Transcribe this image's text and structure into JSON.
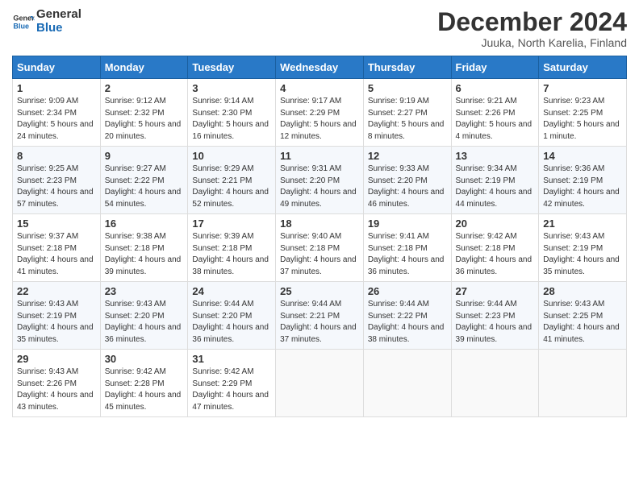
{
  "logo": {
    "line1": "General",
    "line2": "Blue"
  },
  "header": {
    "month": "December 2024",
    "location": "Juuka, North Karelia, Finland"
  },
  "days_of_week": [
    "Sunday",
    "Monday",
    "Tuesday",
    "Wednesday",
    "Thursday",
    "Friday",
    "Saturday"
  ],
  "weeks": [
    [
      {
        "day": "1",
        "sunrise": "9:09 AM",
        "sunset": "2:34 PM",
        "daylight": "5 hours and 24 minutes."
      },
      {
        "day": "2",
        "sunrise": "9:12 AM",
        "sunset": "2:32 PM",
        "daylight": "5 hours and 20 minutes."
      },
      {
        "day": "3",
        "sunrise": "9:14 AM",
        "sunset": "2:30 PM",
        "daylight": "5 hours and 16 minutes."
      },
      {
        "day": "4",
        "sunrise": "9:17 AM",
        "sunset": "2:29 PM",
        "daylight": "5 hours and 12 minutes."
      },
      {
        "day": "5",
        "sunrise": "9:19 AM",
        "sunset": "2:27 PM",
        "daylight": "5 hours and 8 minutes."
      },
      {
        "day": "6",
        "sunrise": "9:21 AM",
        "sunset": "2:26 PM",
        "daylight": "5 hours and 4 minutes."
      },
      {
        "day": "7",
        "sunrise": "9:23 AM",
        "sunset": "2:25 PM",
        "daylight": "5 hours and 1 minute."
      }
    ],
    [
      {
        "day": "8",
        "sunrise": "9:25 AM",
        "sunset": "2:23 PM",
        "daylight": "4 hours and 57 minutes."
      },
      {
        "day": "9",
        "sunrise": "9:27 AM",
        "sunset": "2:22 PM",
        "daylight": "4 hours and 54 minutes."
      },
      {
        "day": "10",
        "sunrise": "9:29 AM",
        "sunset": "2:21 PM",
        "daylight": "4 hours and 52 minutes."
      },
      {
        "day": "11",
        "sunrise": "9:31 AM",
        "sunset": "2:20 PM",
        "daylight": "4 hours and 49 minutes."
      },
      {
        "day": "12",
        "sunrise": "9:33 AM",
        "sunset": "2:20 PM",
        "daylight": "4 hours and 46 minutes."
      },
      {
        "day": "13",
        "sunrise": "9:34 AM",
        "sunset": "2:19 PM",
        "daylight": "4 hours and 44 minutes."
      },
      {
        "day": "14",
        "sunrise": "9:36 AM",
        "sunset": "2:19 PM",
        "daylight": "4 hours and 42 minutes."
      }
    ],
    [
      {
        "day": "15",
        "sunrise": "9:37 AM",
        "sunset": "2:18 PM",
        "daylight": "4 hours and 41 minutes."
      },
      {
        "day": "16",
        "sunrise": "9:38 AM",
        "sunset": "2:18 PM",
        "daylight": "4 hours and 39 minutes."
      },
      {
        "day": "17",
        "sunrise": "9:39 AM",
        "sunset": "2:18 PM",
        "daylight": "4 hours and 38 minutes."
      },
      {
        "day": "18",
        "sunrise": "9:40 AM",
        "sunset": "2:18 PM",
        "daylight": "4 hours and 37 minutes."
      },
      {
        "day": "19",
        "sunrise": "9:41 AM",
        "sunset": "2:18 PM",
        "daylight": "4 hours and 36 minutes."
      },
      {
        "day": "20",
        "sunrise": "9:42 AM",
        "sunset": "2:18 PM",
        "daylight": "4 hours and 36 minutes."
      },
      {
        "day": "21",
        "sunrise": "9:43 AM",
        "sunset": "2:19 PM",
        "daylight": "4 hours and 35 minutes."
      }
    ],
    [
      {
        "day": "22",
        "sunrise": "9:43 AM",
        "sunset": "2:19 PM",
        "daylight": "4 hours and 35 minutes."
      },
      {
        "day": "23",
        "sunrise": "9:43 AM",
        "sunset": "2:20 PM",
        "daylight": "4 hours and 36 minutes."
      },
      {
        "day": "24",
        "sunrise": "9:44 AM",
        "sunset": "2:20 PM",
        "daylight": "4 hours and 36 minutes."
      },
      {
        "day": "25",
        "sunrise": "9:44 AM",
        "sunset": "2:21 PM",
        "daylight": "4 hours and 37 minutes."
      },
      {
        "day": "26",
        "sunrise": "9:44 AM",
        "sunset": "2:22 PM",
        "daylight": "4 hours and 38 minutes."
      },
      {
        "day": "27",
        "sunrise": "9:44 AM",
        "sunset": "2:23 PM",
        "daylight": "4 hours and 39 minutes."
      },
      {
        "day": "28",
        "sunrise": "9:43 AM",
        "sunset": "2:25 PM",
        "daylight": "4 hours and 41 minutes."
      }
    ],
    [
      {
        "day": "29",
        "sunrise": "9:43 AM",
        "sunset": "2:26 PM",
        "daylight": "4 hours and 43 minutes."
      },
      {
        "day": "30",
        "sunrise": "9:42 AM",
        "sunset": "2:28 PM",
        "daylight": "4 hours and 45 minutes."
      },
      {
        "day": "31",
        "sunrise": "9:42 AM",
        "sunset": "2:29 PM",
        "daylight": "4 hours and 47 minutes."
      },
      null,
      null,
      null,
      null
    ]
  ],
  "labels": {
    "sunrise": "Sunrise:",
    "sunset": "Sunset:",
    "daylight": "Daylight:"
  }
}
